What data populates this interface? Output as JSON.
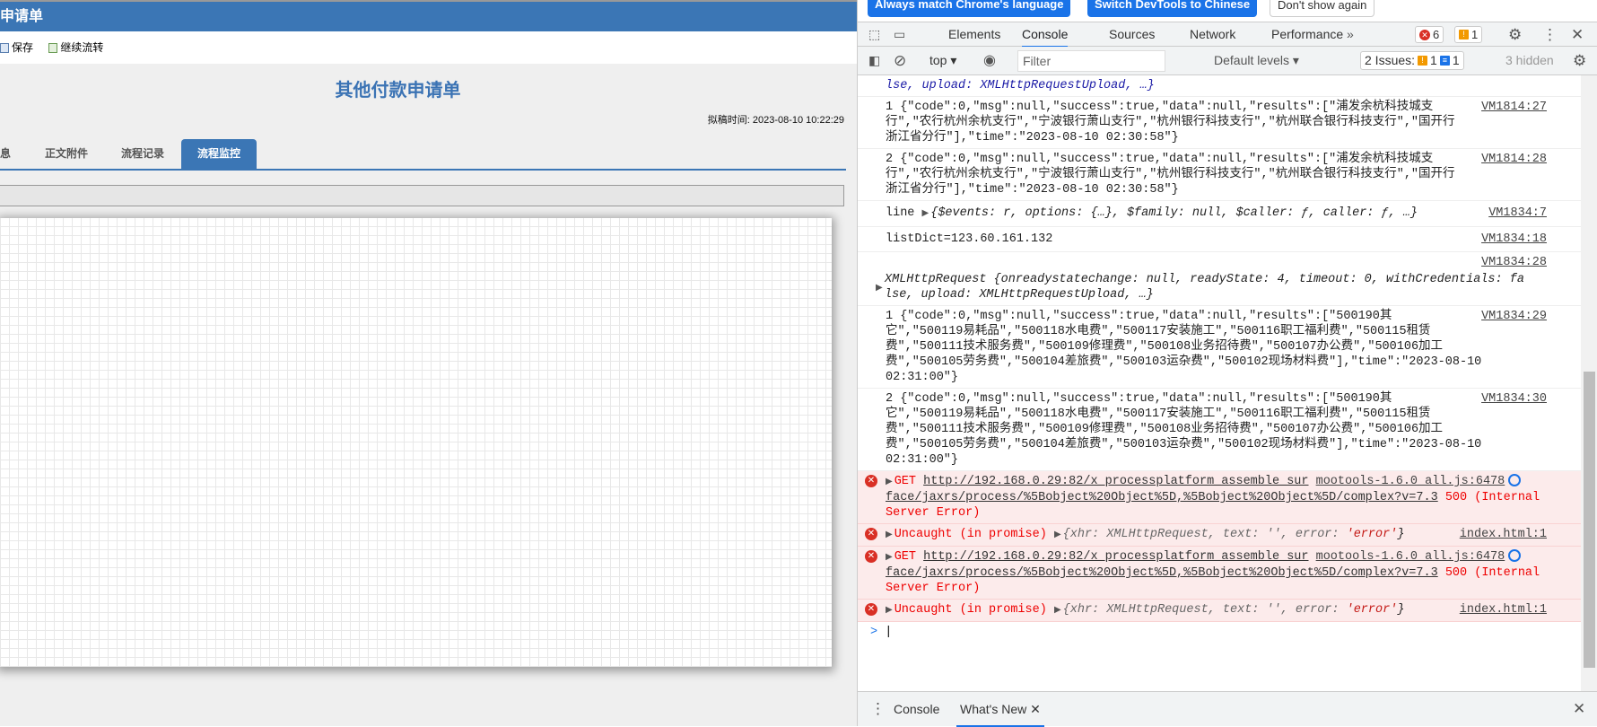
{
  "page": {
    "header_title": "申请单",
    "toolbar": {
      "save": "保存",
      "continue": "继续流转"
    },
    "form_title": "其他付款申请单",
    "draft_time": "拟稿时间: 2023-08-10 10:22:29",
    "tabs": [
      {
        "label": "息"
      },
      {
        "label": "正文附件"
      },
      {
        "label": "流程记录"
      },
      {
        "label": "流程监控",
        "active": true
      }
    ]
  },
  "devtools": {
    "infobar": {
      "match": "Always match Chrome's language",
      "switch": "Switch DevTools to Chinese",
      "dismiss": "Don't show again"
    },
    "tabs": [
      "Elements",
      "Console",
      "Sources",
      "Network",
      "Performance"
    ],
    "active_tab": "Console",
    "more": "»",
    "error_count": "6",
    "warning_count": "1",
    "console_toolbar": {
      "context": "top",
      "filter_placeholder": "Filter",
      "levels": "Default levels",
      "issues_label": "2 Issues:",
      "issues_warn": "1",
      "issues_info": "1",
      "hidden": "3 hidden"
    },
    "messages": [
      {
        "lines": [
          "lse, upload: XMLHttpRequestUpload, …}"
        ]
      },
      {
        "lines": [
          "1 {\"code\":0,\"msg\":null,\"success\":true,\"data\":null,\"results\":[\"浦发余杭科技城支",
          "行\",\"农行杭州余杭支行\",\"宁波银行萧山支行\",\"杭州银行科技支行\",\"杭州联合银行科技支行\",\"国开行",
          "浙江省分行\"],\"time\":\"2023-08-10 02:30:58\"}"
        ],
        "src": "VM1814:27"
      },
      {
        "lines": [
          "2 {\"code\":0,\"msg\":null,\"success\":true,\"data\":null,\"results\":[\"浦发余杭科技城支",
          "行\",\"农行杭州余杭支行\",\"宁波银行萧山支行\",\"杭州银行科技支行\",\"杭州联合银行科技支行\",\"国开行",
          "浙江省分行\"],\"time\":\"2023-08-10 02:30:58\"}"
        ],
        "src": "VM1814:28"
      },
      {
        "label": "line",
        "obj": "{$events: r, options: {…}, $family: null, $caller: ƒ, caller: ƒ, …}",
        "src": "VM1834:7"
      },
      {
        "lines": [
          "listDict=123.60.161.132"
        ],
        "src": "VM1834:18"
      },
      {
        "lines": [
          "XMLHttpRequest {onreadystatechange: null, readyState: 4, timeout: 0, withCredentials: fa",
          "lse, upload: XMLHttpRequestUpload, …}"
        ],
        "src": "VM1834:28"
      },
      {
        "lines": [
          "1 {\"code\":0,\"msg\":null,\"success\":true,\"data\":null,\"results\":[\"500190其",
          "它\",\"500119易耗品\",\"500118水电费\",\"500117安装施工\",\"500116职工福利费\",\"500115租赁",
          "费\",\"500111技术服务费\",\"500109修理费\",\"500108业务招待费\",\"500107办公费\",\"500106加工",
          "费\",\"500105劳务费\",\"500104差旅费\",\"500103运杂费\",\"500102现场材料费\"],\"time\":\"2023-08-10",
          "02:31:00\"}"
        ],
        "src": "VM1834:29"
      },
      {
        "lines": [
          "2 {\"code\":0,\"msg\":null,\"success\":true,\"data\":null,\"results\":[\"500190其",
          "它\",\"500119易耗品\",\"500118水电费\",\"500117安装施工\",\"500116职工福利费\",\"500115租赁",
          "费\",\"500111技术服务费\",\"500109修理费\",\"500108业务招待费\",\"500107办公费\",\"500106加工",
          "费\",\"500105劳务费\",\"500104差旅费\",\"500103运杂费\",\"500102现场材料费\"],\"time\":\"2023-08-10",
          "02:31:00\"}"
        ],
        "src": "VM1834:30"
      }
    ],
    "errors": [
      {
        "method": "GET",
        "url1": "http://192.168.0.29:82/x_processplatform_assemble_sur",
        "url2": "face/jaxrs/process/%5Bobject%20Object%5D,%5Bobject%20Object%5D/complex?v=7.3",
        "status": "500 (Internal",
        "status2": "Server Error)",
        "src": "mootools-1.6.0_all.js:6478"
      },
      {
        "text": "Uncaught (in promise)",
        "obj_pre": "{xhr: XMLHttpRequest, text: '', error: ",
        "obj_err": "'error'",
        "obj_post": "}",
        "src": "index.html:1"
      }
    ],
    "prompt": ">",
    "drawer": {
      "console": "Console",
      "whats_new": "What's New"
    }
  }
}
